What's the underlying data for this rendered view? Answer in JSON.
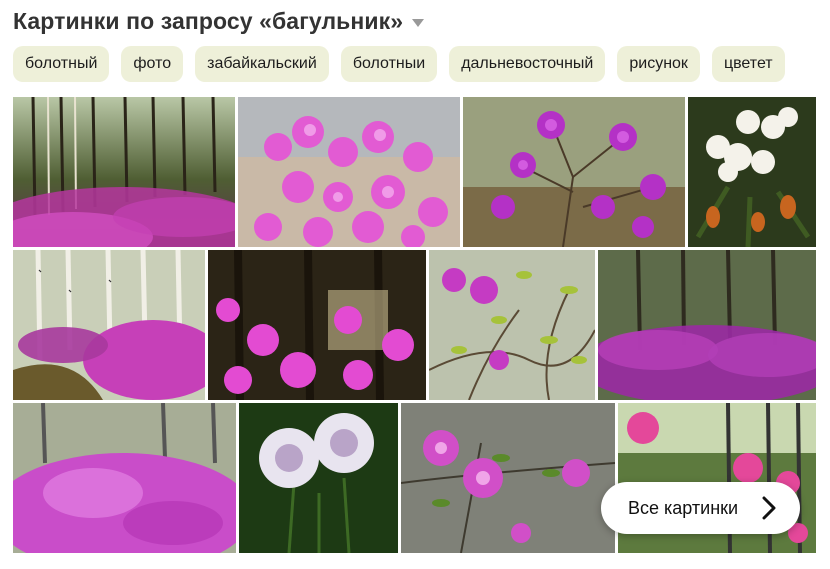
{
  "header": {
    "title": "Картинки по запросу «багульник»"
  },
  "chips": [
    "болотный",
    "фото",
    "забайкальский",
    "болотныи",
    "дальневосточный",
    "рисунок",
    "цветет"
  ],
  "all_images_label": "Все картинки",
  "colors": {
    "chip_bg": "#eef0d9",
    "magenta": "#c93cc0",
    "pink": "#e36fd9",
    "forest": "#3d4a2a"
  },
  "icons": {
    "dropdown": "caret-down-icon",
    "arrow": "chevron-right-icon"
  }
}
